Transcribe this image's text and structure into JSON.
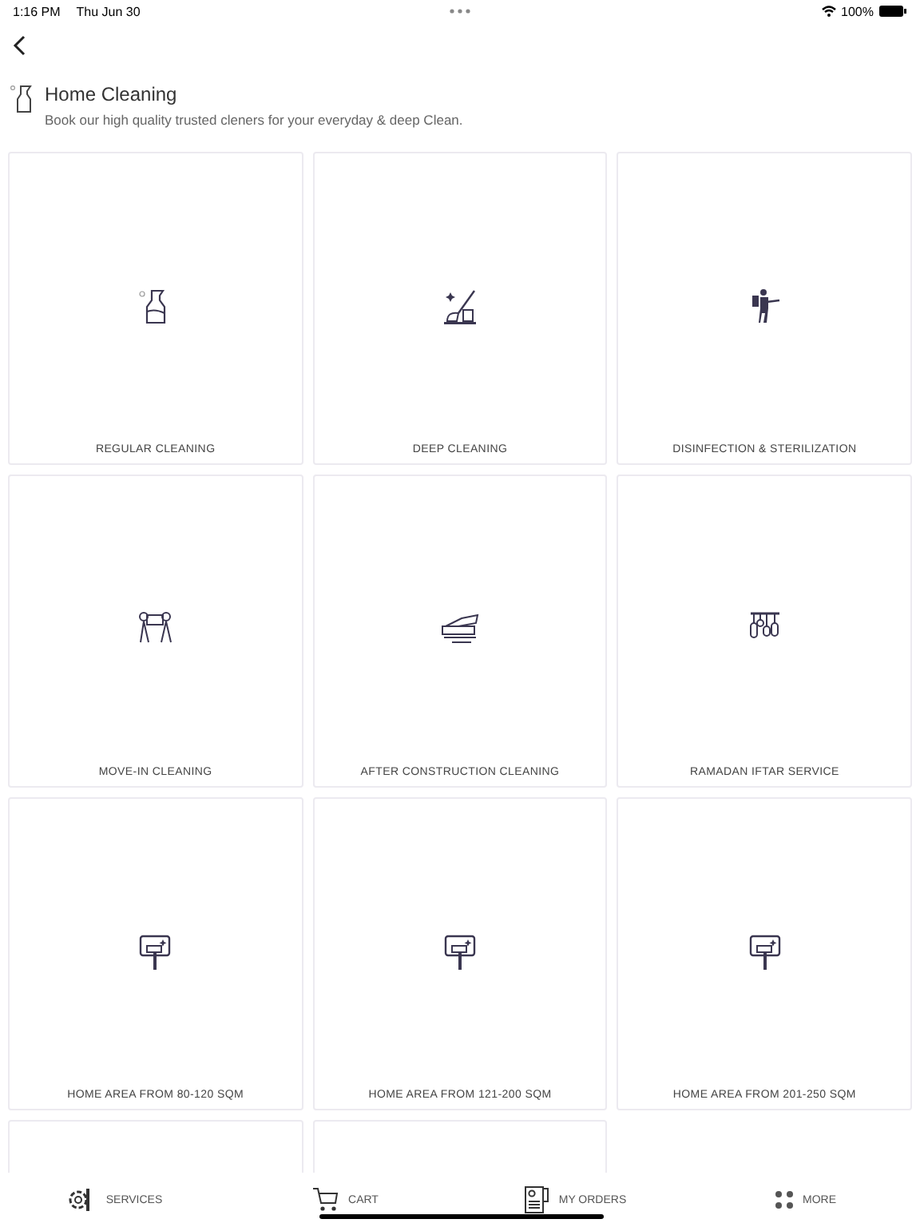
{
  "status_bar": {
    "time": "1:16 PM",
    "date": "Thu Jun 30",
    "battery": "100%"
  },
  "header": {
    "title": "Home Cleaning",
    "subtitle": "Book our high quality trusted cleners for your everyday & deep Clean."
  },
  "services": [
    {
      "kind": "spray",
      "label": "REGULAR CLEANING"
    },
    {
      "kind": "mop",
      "label": "DEEP CLEANING"
    },
    {
      "kind": "sprayer",
      "label": "DISINFECTION & STERILIZATION"
    },
    {
      "kind": "movers",
      "label": "MOVE-IN CLEANING"
    },
    {
      "kind": "construction",
      "label": "AFTER CONSTRUCTION CLEANING"
    },
    {
      "kind": "lanterns",
      "label": "RAMADAN IFTAR SERVICE"
    },
    {
      "kind": "roller",
      "label": "HOME AREA FROM 80-120 SQM"
    },
    {
      "kind": "roller",
      "label": "HOME AREA FROM 121-200 SQM"
    },
    {
      "kind": "roller",
      "label": "HOME AREA FROM 201-250 SQM"
    },
    {
      "kind": "partial"
    },
    {
      "kind": "partial"
    }
  ],
  "tab_bar": [
    {
      "kind": "services",
      "label": "SERVICES"
    },
    {
      "kind": "cart",
      "label": "CART"
    },
    {
      "kind": "orders",
      "label": "MY ORDERS"
    },
    {
      "kind": "more",
      "label": "MORE"
    }
  ]
}
